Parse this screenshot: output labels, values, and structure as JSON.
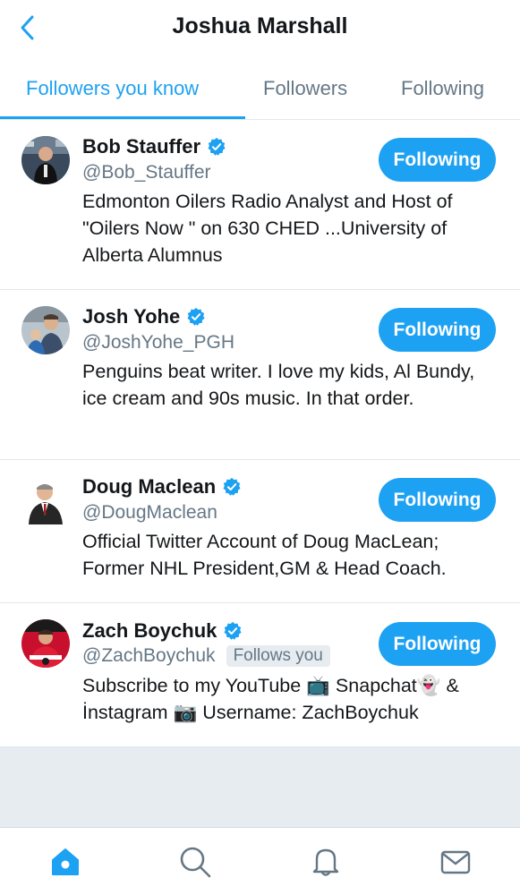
{
  "header": {
    "title": "Joshua Marshall",
    "back_icon": "chevron-left-icon"
  },
  "tabs": [
    {
      "label": "Followers you know",
      "active": true
    },
    {
      "label": "Followers",
      "active": false
    },
    {
      "label": "Following",
      "active": false
    }
  ],
  "users": [
    {
      "name": "Bob Stauffer",
      "handle": "@Bob_Stauffer",
      "verified": true,
      "follows_you": false,
      "bio": "Edmonton Oilers Radio Analyst and Host of \"Oilers Now \" on 630 CHED ...University of Alberta Alumnus",
      "button_label": "Following"
    },
    {
      "name": "Josh Yohe",
      "handle": "@JoshYohe_PGH",
      "verified": true,
      "follows_you": false,
      "bio": "Penguins beat writer. I love my kids, Al Bundy, ice cream and 90s music. In that order.",
      "button_label": "Following"
    },
    {
      "name": "Doug Maclean",
      "handle": "@DougMaclean",
      "verified": true,
      "follows_you": false,
      "bio": "Official Twitter Account of Doug MacLean; Former NHL President,GM & Head Coach.",
      "button_label": "Following"
    },
    {
      "name": "Zach Boychuk",
      "handle": "@ZachBoychuk",
      "verified": true,
      "follows_you": true,
      "follows_you_label": "Follows you",
      "bio": "Subscribe to my YouTube 📺 Snapchat👻 & İnstagram 📷 Username: ZachBoychuk",
      "button_label": "Following"
    }
  ],
  "bottom_nav": [
    {
      "icon": "home-icon",
      "active": true
    },
    {
      "icon": "search-icon",
      "active": false
    },
    {
      "icon": "bell-icon",
      "active": false
    },
    {
      "icon": "mail-icon",
      "active": false
    }
  ],
  "colors": {
    "accent": "#1da1f2",
    "text_primary": "#14171a",
    "text_secondary": "#657786",
    "divider": "#e1e8ed",
    "background_gray": "#e6ecf0"
  }
}
